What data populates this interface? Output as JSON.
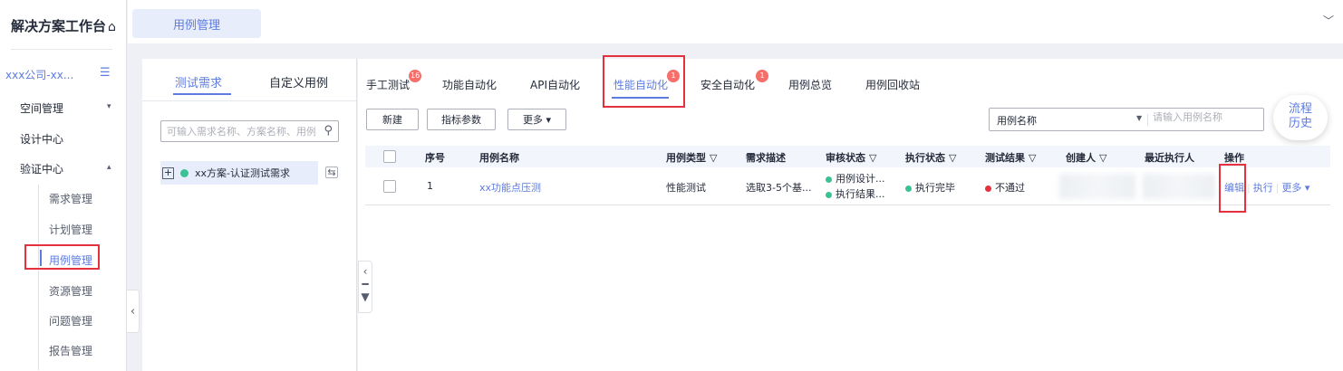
{
  "sidebar": {
    "title": "解决方案工作台",
    "home_icon": "home-icon",
    "company": "xxx公司-xx...",
    "menu_icon": "menu-collapse-icon",
    "groups": [
      {
        "label": "空间管理",
        "arrow": "▾"
      },
      {
        "label": "设计中心"
      },
      {
        "label": "验证中心",
        "arrow": "▴"
      }
    ],
    "sub_items": [
      "需求管理",
      "计划管理",
      "用例管理",
      "资源管理",
      "问题管理",
      "报告管理"
    ],
    "active_sub": "用例管理"
  },
  "topbar": {
    "tab_label": "用例管理",
    "chevron": "﹀"
  },
  "tree": {
    "tabs": [
      "测试需求",
      "自定义用例"
    ],
    "search_placeholder": "可输入需求名称、方案名称、用例",
    "node_label": "xx方案-认证测试需求",
    "node_icon": "⇆"
  },
  "main": {
    "tabs": [
      {
        "label": "手工测试",
        "badge": "16"
      },
      {
        "label": "功能自动化"
      },
      {
        "label": "API自动化"
      },
      {
        "label": "性能自动化",
        "badge": "1"
      },
      {
        "label": "安全自动化",
        "badge": "1"
      },
      {
        "label": "用例总览"
      },
      {
        "label": "用例回收站"
      }
    ],
    "buttons": {
      "new": "新建",
      "metrics": "指标参数",
      "more": "更多 ▾"
    },
    "search_select": "用例名称",
    "search_placeholder": "请输入用例名称",
    "history_line1": "流程",
    "history_line2": "历史",
    "columns": [
      "序号",
      "用例名称",
      "用例类型",
      "需求描述",
      "审核状态",
      "执行状态",
      "测试结果",
      "创建人",
      "最近执行人",
      "操作"
    ],
    "row": {
      "index": "1",
      "name": "xx功能点压测",
      "type": "性能测试",
      "desc": "选取3-5个基...",
      "review_1": "用例设计...",
      "review_2": "执行结果...",
      "exec_status": "执行完毕",
      "result": "不通过",
      "op_edit": "编辑",
      "op_run": "执行",
      "op_more": "更多 ▾"
    }
  },
  "colors": {
    "accent": "#5e7ce0",
    "success": "#3ac295",
    "danger": "#e4313d",
    "highlight_box": "#e4313d"
  }
}
